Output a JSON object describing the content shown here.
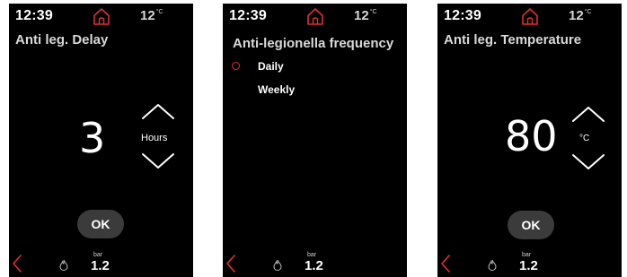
{
  "accent_color": "#e03030",
  "screens": [
    {
      "status": {
        "time": "12:39",
        "home_icon": "home-icon",
        "outside_temp": "12",
        "outside_temp_unit": "°C"
      },
      "title": "Anti leg. Delay",
      "value": "3",
      "unit": "Hours",
      "ok_label": "OK",
      "bottom": {
        "pressure_unit": "bar",
        "pressure_value": "1.2"
      }
    },
    {
      "status": {
        "time": "12:39",
        "home_icon": "home-icon",
        "outside_temp": "12",
        "outside_temp_unit": "°C"
      },
      "title": "Anti-legionella frequency",
      "options": [
        {
          "label": "Daily",
          "selected": true
        },
        {
          "label": "Weekly",
          "selected": false
        }
      ],
      "bottom": {
        "pressure_unit": "bar",
        "pressure_value": "1.2"
      }
    },
    {
      "status": {
        "time": "12:39",
        "home_icon": "home-icon",
        "outside_temp": "12",
        "outside_temp_unit": "°C"
      },
      "title": "Anti leg. Temperature",
      "value": "80",
      "unit": "°C",
      "ok_label": "OK",
      "bottom": {
        "pressure_unit": "bar",
        "pressure_value": "1.2"
      }
    }
  ]
}
